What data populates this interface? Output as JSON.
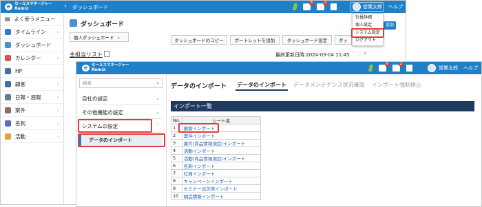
{
  "colors": {
    "header_blue": "#1f80c8",
    "highlight_red": "#e53935",
    "list_header": "#1f3a5e"
  },
  "app": {
    "logo_line1": "セールスマネージャー",
    "logo_line2": "Remix",
    "logo_mark": "e"
  },
  "back": {
    "page_title": "ダッシュボード",
    "breadcrumb": "ダッシュボード",
    "badges": {
      "chat": "6",
      "mail": "2"
    },
    "user": "営業太郎",
    "help": "ヘルプ",
    "user_menu": [
      "社員詳細",
      "個人設定",
      "システム設定",
      "ログアウト"
    ],
    "sidebar": {
      "favorites": "よく使うメニュー",
      "items": [
        {
          "label": "タイムライン",
          "icon": "timeline-icon",
          "color": "#2e7dd1"
        },
        {
          "label": "ダッシュボード",
          "icon": "dashboard-icon",
          "color": "#4a90d9"
        },
        {
          "label": "カレンダー",
          "icon": "calendar-icon",
          "color": "#d9534f"
        },
        {
          "label": "HP",
          "icon": "hp-icon",
          "color": "#4a6fa5"
        },
        {
          "label": "顧客",
          "icon": "customer-icon",
          "color": "#3f6ea8"
        },
        {
          "label": "日報・週報",
          "icon": "report-icon",
          "color": "#607d8b"
        },
        {
          "label": "案件",
          "icon": "deal-icon",
          "color": "#8d6e63"
        },
        {
          "label": "名刺",
          "icon": "card-icon",
          "color": "#5c6bc0"
        },
        {
          "label": "活動",
          "icon": "activity-icon",
          "color": "#e6a23c"
        }
      ]
    },
    "personal_dashboard": "個人ダッシュボード",
    "buttons": [
      "ダッシュボードのコピー",
      "ポートレットを追加",
      "ダッシュボード設定",
      "ダッ"
    ],
    "add_label": "追加",
    "portlet_title": "主担当リスト",
    "updated": "最終更新日時:2024-03-04 11:45"
  },
  "front": {
    "badges": {
      "chat": "6",
      "mail": "2"
    },
    "user": "営業太郎",
    "help": "ヘルプ",
    "search_placeholder": "検索",
    "menu": {
      "company": "自社の設定",
      "other": "その他機能の設定",
      "system": "システムの設定",
      "data_import": "データのインポート"
    },
    "page_title": "データのインポート",
    "tabs": [
      "データのインポート",
      "データメンテナンス状況確認",
      "インポート強制停止"
    ],
    "list_title": "インポート一覧",
    "table": {
      "headers": [
        "No.",
        "シート名"
      ],
      "rows": [
        [
          "1",
          "顧客インポート"
        ],
        [
          "2",
          "案件インポート"
        ],
        [
          "3",
          "案件(商品情報項目)インポート"
        ],
        [
          "4",
          "活動インポート"
        ],
        [
          "5",
          "活動(商品情報項目)インポート"
        ],
        [
          "6",
          "名刺インポート"
        ],
        [
          "7",
          "社員インポート"
        ],
        [
          "8",
          "キャンペーンインポート"
        ],
        [
          "9",
          "セミナー出欠席インポート"
        ],
        [
          "10",
          "納品情報インポート"
        ]
      ]
    }
  }
}
